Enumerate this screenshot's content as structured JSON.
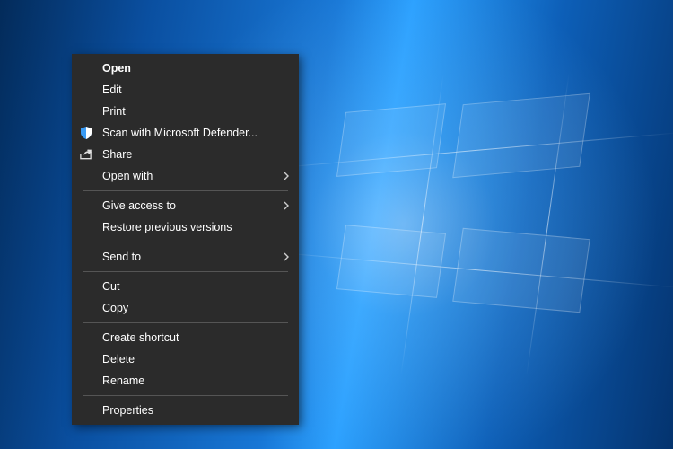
{
  "context_menu": {
    "items": [
      {
        "label": "Open",
        "bold": true
      },
      {
        "label": "Edit"
      },
      {
        "label": "Print"
      },
      {
        "label": "Scan with Microsoft Defender...",
        "icon": "shield"
      },
      {
        "label": "Share",
        "icon": "share"
      },
      {
        "label": "Open with",
        "submenu": true
      },
      {
        "sep": true
      },
      {
        "label": "Give access to",
        "submenu": true
      },
      {
        "label": "Restore previous versions"
      },
      {
        "sep": true
      },
      {
        "label": "Send to",
        "submenu": true
      },
      {
        "sep": true
      },
      {
        "label": "Cut"
      },
      {
        "label": "Copy"
      },
      {
        "sep": true
      },
      {
        "label": "Create shortcut"
      },
      {
        "label": "Delete"
      },
      {
        "label": "Rename"
      },
      {
        "sep": true
      },
      {
        "label": "Properties"
      }
    ]
  }
}
